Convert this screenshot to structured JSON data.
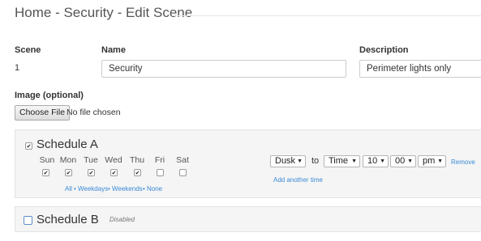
{
  "page": {
    "title": "Home - Security - Edit Scene"
  },
  "scene": {
    "scene_label": "Scene",
    "scene_value": "1",
    "name_label": "Name",
    "name_value": "Security",
    "description_label": "Description",
    "description_value": "Perimeter lights only"
  },
  "image": {
    "label": "Image (optional)",
    "button_label": "Choose File",
    "status": "No file chosen"
  },
  "schedule_a": {
    "title": "Schedule A",
    "enabled": true,
    "days": [
      {
        "label": "Sun",
        "checked": true
      },
      {
        "label": "Mon",
        "checked": true
      },
      {
        "label": "Tue",
        "checked": true
      },
      {
        "label": "Wed",
        "checked": true
      },
      {
        "label": "Thu",
        "checked": true
      },
      {
        "label": "Fri",
        "checked": false
      },
      {
        "label": "Sat",
        "checked": false
      }
    ],
    "quick_links": {
      "all": "All",
      "weekdays": "Weekdays",
      "weekends": "Weekends",
      "none": "None",
      "separator": "•"
    },
    "time": {
      "start": "Dusk",
      "to_label": "to",
      "end_type": "Time",
      "hour": "10",
      "minute": "00",
      "ampm": "pm",
      "remove_label": "Remove",
      "add_label": "Add another time"
    }
  },
  "schedule_b": {
    "title": "Schedule B",
    "status": "Disabled",
    "enabled": false
  },
  "colors": {
    "link": "#3a8ad6",
    "panel_bg": "#f5f5f5",
    "checkbox_blue": "#5b8ec9"
  }
}
